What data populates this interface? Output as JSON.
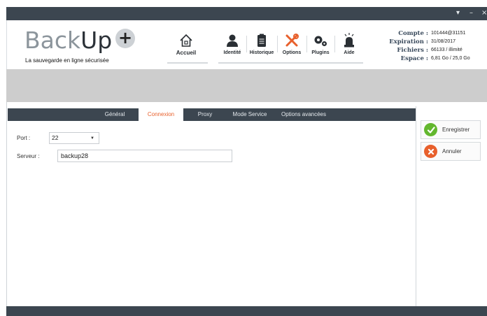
{
  "titlebar": {
    "controls": [
      {
        "name": "menu-icon",
        "glyph": "▾"
      },
      {
        "name": "minimize-icon",
        "glyph": "–"
      },
      {
        "name": "close-icon",
        "glyph": "×"
      }
    ]
  },
  "brand": {
    "name_part1": "Back",
    "name_part2": "Up",
    "plus": "+",
    "tagline": "La sauvegarde en ligne sécurisée"
  },
  "nav": {
    "items": [
      {
        "label": "Accueil",
        "icon": "home-icon"
      },
      {
        "label": "Identité",
        "icon": "user-icon"
      },
      {
        "label": "Historique",
        "icon": "history-icon"
      },
      {
        "label": "Options",
        "icon": "tools-icon"
      },
      {
        "label": "Plugins",
        "icon": "gears-icon"
      },
      {
        "label": "Aide",
        "icon": "siren-icon"
      }
    ]
  },
  "account": {
    "compte_label": "Compte :",
    "compte_value": "101444@31151",
    "expiration_label": "Expiration :",
    "expiration_value": "31/08/2017",
    "fichiers_label": "Fichiers :",
    "fichiers_value": "66133 / illimité",
    "espace_label": "Espace :",
    "espace_value": "6,81 Go / 25,0 Go"
  },
  "tabs": {
    "items": [
      "Général",
      "Connexion",
      "Proxy",
      "Mode Service",
      "Options avancées"
    ],
    "active_index": 1
  },
  "form": {
    "port_label": "Port :",
    "port_value": "22",
    "serveur_label": "Serveur :",
    "serveur_value": "backup28"
  },
  "actions": {
    "save_label": "Enregistrer",
    "cancel_label": "Annuler"
  },
  "colors": {
    "chrome_dark": "#3c4650",
    "active_tab_text": "#e8602c",
    "save_green": "#63b72e",
    "cancel_orange": "#e8602c",
    "banner_gray": "#cdcdcd"
  }
}
